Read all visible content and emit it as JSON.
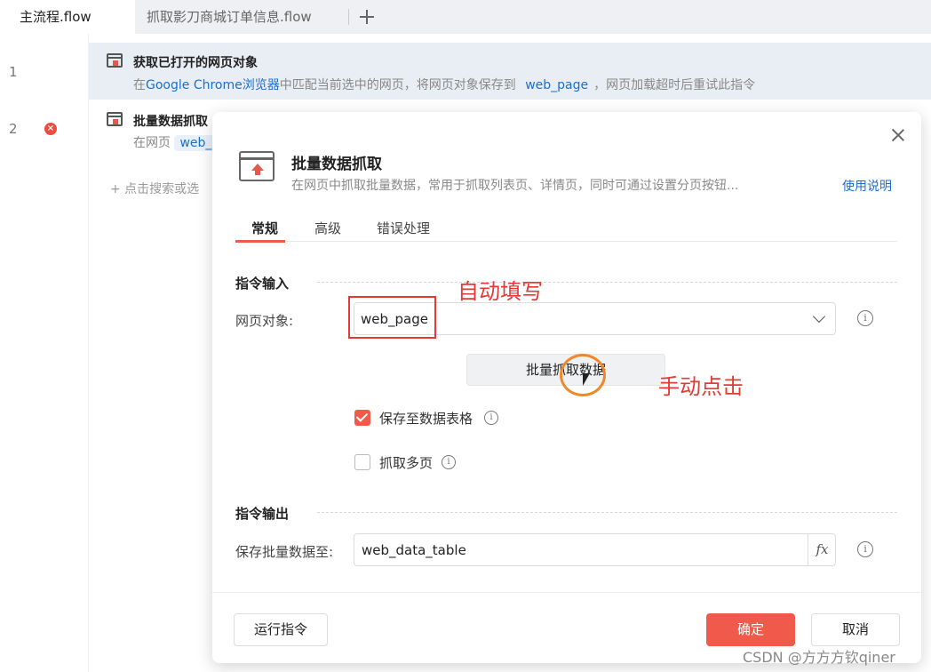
{
  "tabs": [
    {
      "label": "主流程.flow"
    },
    {
      "label": "抓取影刀商城订单信息.flow"
    }
  ],
  "gutter": {
    "lines": [
      "1",
      "2"
    ],
    "error_mark": "×"
  },
  "steps": [
    {
      "title": "获取已打开的网页对象",
      "desc_prefix": "在",
      "desc_link": "Google Chrome浏览器",
      "desc_mid": "中匹配当前选中的网页，将网页对象保存到",
      "desc_var": "web_page",
      "desc_suffix": "，网页加载超时后重试此指令"
    },
    {
      "title": "批量数据抓取",
      "desc_prefix": "在网页",
      "desc_var": "web_"
    }
  ],
  "add_step": "+ 点击搜索或选",
  "dialog": {
    "title": "批量数据抓取",
    "desc": "在网页中抓取批量数据，常用于抓取列表页、详情页，同时可通过设置分页按钮...",
    "help": "使用说明",
    "tabs": [
      "常规",
      "高级",
      "错误处理"
    ],
    "input_section": "指令输入",
    "web_object_label": "网页对象:",
    "web_object_value": "web_page",
    "batch_button": "批量抓取数据",
    "save_table_label": "保存至数据表格",
    "multi_page_label": "抓取多页",
    "save_table_checked": true,
    "multi_page_checked": false,
    "output_section": "指令输出",
    "output_label": "保存批量数据至:",
    "output_value": "web_data_table",
    "fx": "fx",
    "info": "i",
    "run_button": "运行指令",
    "ok_button": "确定",
    "cancel_button": "取消"
  },
  "annotations": {
    "auto_fill": "自动填写",
    "manual_click": "手动点击"
  },
  "watermark": "CSDN @方方方钦qiner",
  "colors": {
    "accent": "#ef5a4a",
    "link": "#1b6fcf",
    "annotation": "#e53935",
    "highlight": "#f0882a"
  }
}
